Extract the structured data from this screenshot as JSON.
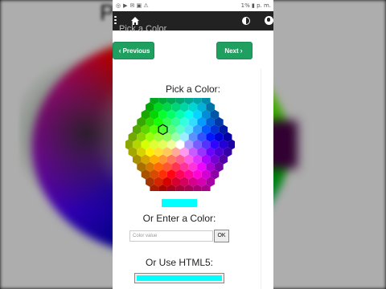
{
  "background": {
    "title_fragment": "P"
  },
  "status_bar": {
    "icons": [
      "whatsapp-icon",
      "video-icon",
      "notification-icons",
      "battery-icon"
    ],
    "percent": "1%",
    "time": "p. m."
  },
  "navbar": {
    "icons": [
      "menu-icon",
      "home-icon",
      "contrast-icon",
      "globe-icon"
    ]
  },
  "page": {
    "top_text": "Pick a Color",
    "previous_label": "Previous",
    "next_label": "Next",
    "pick_label": "Pick a Color:",
    "selected_color": "#00ffff",
    "enter_label": "Or Enter a Color:",
    "input_placeholder": "Color value",
    "ok_label": "OK",
    "html5_label": "Or Use HTML5:",
    "html5_value": "#00ffff"
  }
}
